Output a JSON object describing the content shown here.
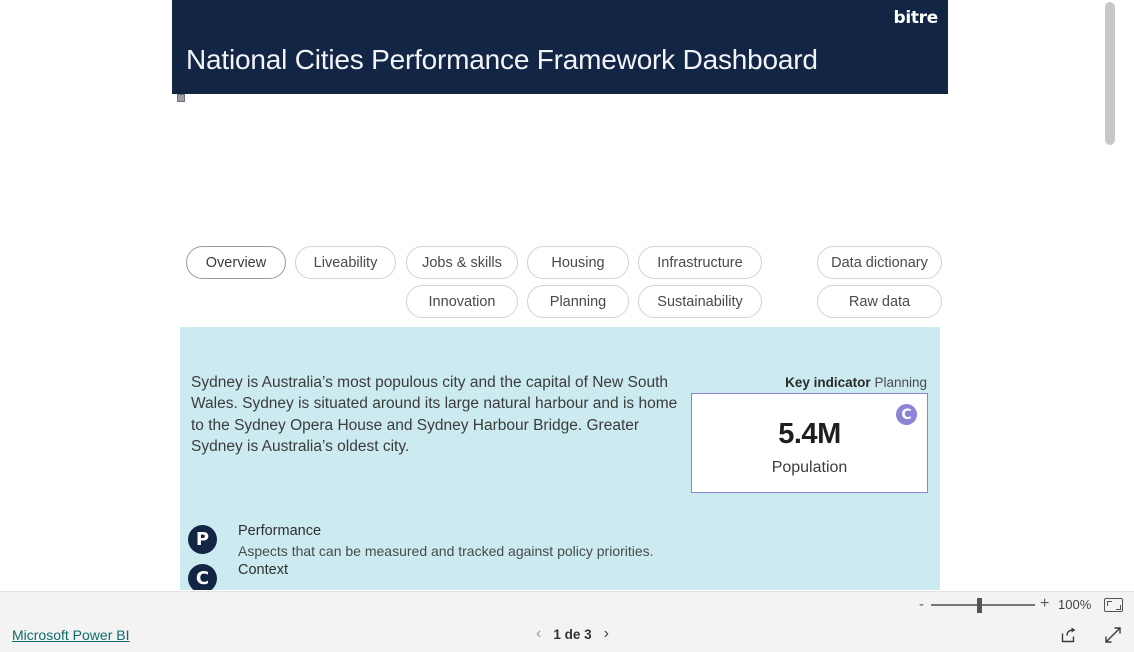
{
  "banner": {
    "logo": "bitre",
    "title": "National Cities Performance Framework Dashboard"
  },
  "nav": {
    "row1": [
      {
        "label": "Overview",
        "selected": true
      },
      {
        "label": "Liveability",
        "selected": false
      },
      {
        "label": "Jobs & skills",
        "selected": false
      },
      {
        "label": "Housing",
        "selected": false
      },
      {
        "label": "Infrastructure",
        "selected": false
      },
      {
        "label": "Data dictionary",
        "selected": false
      }
    ],
    "row2": [
      {
        "label": "Innovation",
        "selected": false
      },
      {
        "label": "Planning",
        "selected": false
      },
      {
        "label": "Sustainability",
        "selected": false
      },
      {
        "label": "Raw data",
        "selected": false
      }
    ]
  },
  "content": {
    "city_description": "Sydney is Australia’s most populous city and the capital of New South Wales. Sydney is situated around its large natural harbour and is home to the Sydney Opera House and Sydney Harbour Bridge. Greater Sydney is Australia’s oldest city.",
    "key_indicator": {
      "label_bold": "Key indicator",
      "label_rest": "Planning",
      "badge": "C",
      "value": "5.4M",
      "metric": "Population"
    },
    "legend": [
      {
        "icon": "P",
        "title": "Performance",
        "description": "Aspects that can be measured and tracked against policy priorities."
      },
      {
        "icon": "C",
        "title": "Context",
        "description": ""
      }
    ]
  },
  "zoom_bar": {
    "minus": "-",
    "plus": "+",
    "percent": "100%"
  },
  "footer": {
    "powerbi_link": "Microsoft Power BI",
    "page_label": "1 de 3",
    "prev": "‹",
    "next": "›"
  },
  "colors": {
    "banner_bg": "#122544",
    "panel_bg": "#cbebf0",
    "accent_purple": "#8b84d7",
    "link_teal": "#0f6b6b"
  }
}
